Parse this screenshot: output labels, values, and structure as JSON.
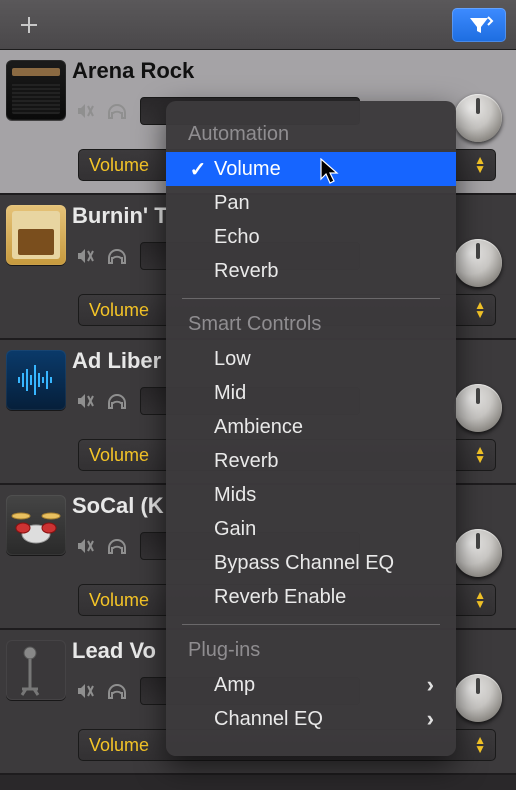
{
  "toolbar": {
    "add_icon": "plus-icon",
    "filter_icon": "filter-icon"
  },
  "tracks": [
    {
      "name": "Arena Rock",
      "param": "Volume",
      "icon": "amp-dark"
    },
    {
      "name": "Burnin' T",
      "param": "Volume",
      "icon": "amp-tweed"
    },
    {
      "name": "Ad Liber",
      "param": "Volume",
      "icon": "waveform"
    },
    {
      "name": "SoCal (K",
      "param": "Volume",
      "icon": "drums"
    },
    {
      "name": "Lead Vo",
      "param": "Volume",
      "icon": "mic"
    }
  ],
  "menu": {
    "sections": [
      {
        "label": "Automation",
        "items": [
          {
            "label": "Volume",
            "checked": true,
            "selected": true
          },
          {
            "label": "Pan"
          },
          {
            "label": "Echo"
          },
          {
            "label": "Reverb"
          }
        ]
      },
      {
        "label": "Smart Controls",
        "items": [
          {
            "label": "Low"
          },
          {
            "label": "Mid"
          },
          {
            "label": "Ambience"
          },
          {
            "label": "Reverb"
          },
          {
            "label": "Mids"
          },
          {
            "label": "Gain"
          },
          {
            "label": "Bypass Channel EQ"
          },
          {
            "label": "Reverb Enable"
          }
        ]
      },
      {
        "label": "Plug-ins",
        "items": [
          {
            "label": "Amp",
            "submenu": true
          },
          {
            "label": "Channel EQ",
            "submenu": true
          }
        ]
      }
    ]
  }
}
